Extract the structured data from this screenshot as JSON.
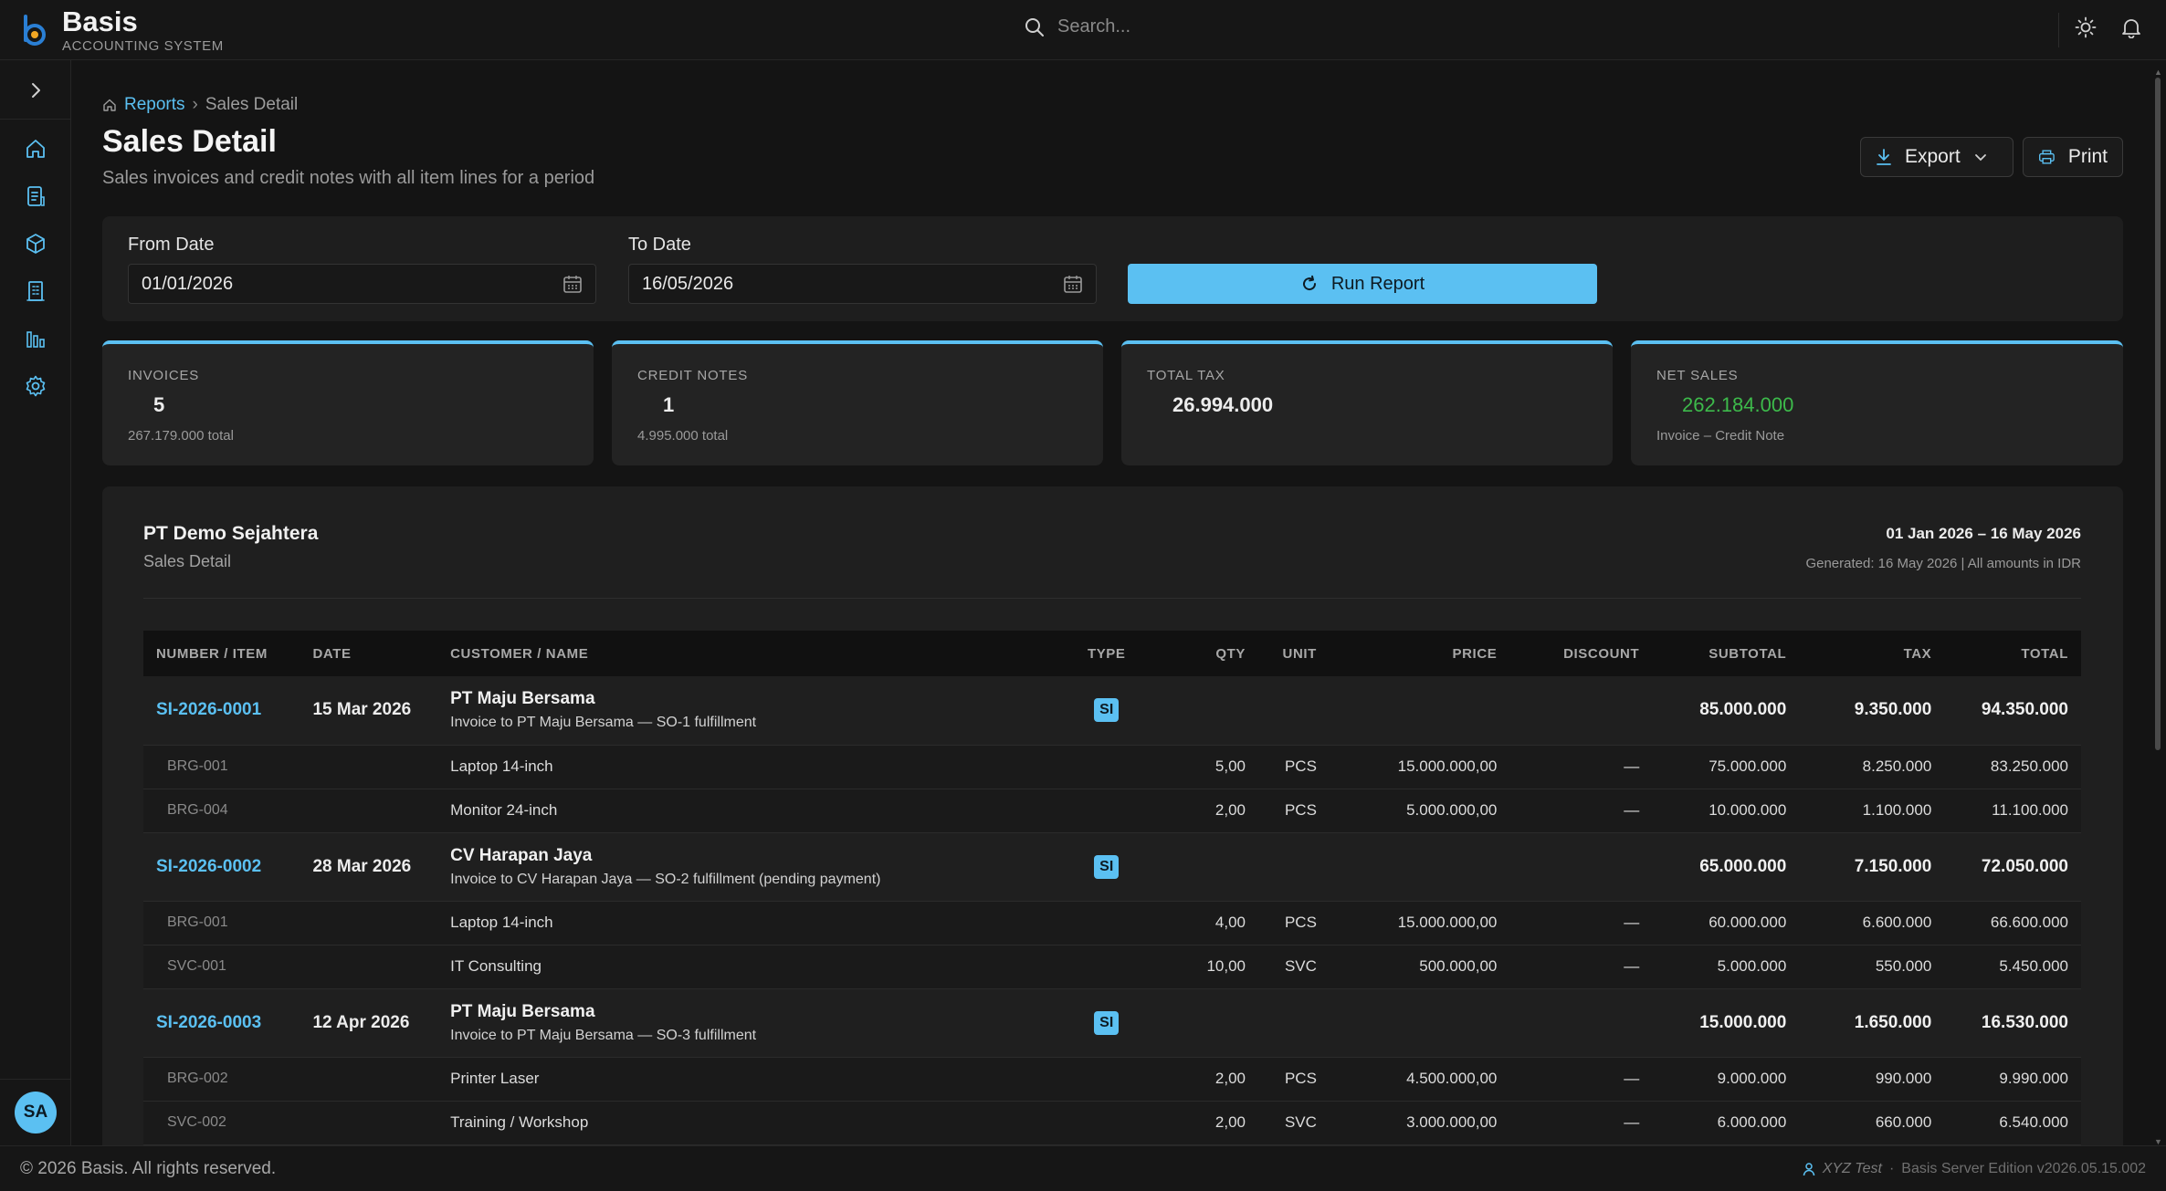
{
  "app": {
    "name": "Basis",
    "subtitle": "ACCOUNTING SYSTEM"
  },
  "search": {
    "placeholder": "Search..."
  },
  "user": {
    "initials": "SA"
  },
  "breadcrumb": {
    "parent": "Reports",
    "separator": "›",
    "current": "Sales Detail"
  },
  "page": {
    "title": "Sales Detail",
    "subtitle": "Sales invoices and credit notes with all item lines for a period"
  },
  "actions": {
    "export_label": "Export",
    "print_label": "Print"
  },
  "filters": {
    "from_label": "From Date",
    "from_value": "01/01/2026",
    "to_label": "To Date",
    "to_value": "16/05/2026",
    "run_label": "Run Report"
  },
  "stats": [
    {
      "label": "INVOICES",
      "value": "5",
      "sub": "267.179.000 total"
    },
    {
      "label": "CREDIT NOTES",
      "value": "1",
      "sub": "4.995.000 total"
    },
    {
      "label": "TOTAL TAX",
      "value": "26.994.000",
      "sub": ""
    },
    {
      "label": "NET SALES",
      "value": "262.184.000",
      "sub": "Invoice – Credit Note"
    }
  ],
  "report": {
    "company": "PT Demo Sejahtera",
    "name": "Sales Detail",
    "period": "01 Jan 2026 – 16 May 2026",
    "generated": "Generated: 16 May 2026 | All amounts in IDR"
  },
  "table": {
    "headers": [
      "NUMBER / ITEM",
      "DATE",
      "CUSTOMER / NAME",
      "TYPE",
      "QTY",
      "UNIT",
      "PRICE",
      "DISCOUNT",
      "SUBTOTAL",
      "TAX",
      "TOTAL"
    ],
    "invoices": [
      {
        "number": "SI-2026-0001",
        "date": "15 Mar 2026",
        "customer": "PT Maju Bersama",
        "desc": "Invoice to PT Maju Bersama — SO-1 fulfillment",
        "type": "SI",
        "subtotal": "85.000.000",
        "tax": "9.350.000",
        "total": "94.350.000",
        "lines": [
          {
            "code": "BRG-001",
            "name": "Laptop 14-inch",
            "qty": "5,00",
            "unit": "PCS",
            "price": "15.000.000,00",
            "discount": "—",
            "subtotal": "75.000.000",
            "tax": "8.250.000",
            "total": "83.250.000"
          },
          {
            "code": "BRG-004",
            "name": "Monitor 24-inch",
            "qty": "2,00",
            "unit": "PCS",
            "price": "5.000.000,00",
            "discount": "—",
            "subtotal": "10.000.000",
            "tax": "1.100.000",
            "total": "11.100.000"
          }
        ]
      },
      {
        "number": "SI-2026-0002",
        "date": "28 Mar 2026",
        "customer": "CV Harapan Jaya",
        "desc": "Invoice to CV Harapan Jaya — SO-2 fulfillment (pending payment)",
        "type": "SI",
        "subtotal": "65.000.000",
        "tax": "7.150.000",
        "total": "72.050.000",
        "lines": [
          {
            "code": "BRG-001",
            "name": "Laptop 14-inch",
            "qty": "4,00",
            "unit": "PCS",
            "price": "15.000.000,00",
            "discount": "—",
            "subtotal": "60.000.000",
            "tax": "6.600.000",
            "total": "66.600.000"
          },
          {
            "code": "SVC-001",
            "name": "IT Consulting",
            "qty": "10,00",
            "unit": "SVC",
            "price": "500.000,00",
            "discount": "—",
            "subtotal": "5.000.000",
            "tax": "550.000",
            "total": "5.450.000"
          }
        ]
      },
      {
        "number": "SI-2026-0003",
        "date": "12 Apr 2026",
        "customer": "PT Maju Bersama",
        "desc": "Invoice to PT Maju Bersama — SO-3 fulfillment",
        "type": "SI",
        "subtotal": "15.000.000",
        "tax": "1.650.000",
        "total": "16.530.000",
        "lines": [
          {
            "code": "BRG-002",
            "name": "Printer Laser",
            "qty": "2,00",
            "unit": "PCS",
            "price": "4.500.000,00",
            "discount": "—",
            "subtotal": "9.000.000",
            "tax": "990.000",
            "total": "9.990.000"
          },
          {
            "code": "SVC-002",
            "name": "Training / Workshop",
            "qty": "2,00",
            "unit": "SVC",
            "price": "3.000.000,00",
            "discount": "—",
            "subtotal": "6.000.000",
            "tax": "660.000",
            "total": "6.540.000"
          }
        ]
      }
    ]
  },
  "footer": {
    "copyright": "© 2026 Basis. All rights reserved.",
    "user": "XYZ Test",
    "edition": "Basis Server Edition v2026.05.15.002"
  },
  "colors": {
    "accent": "#5bc0f2",
    "positive": "#3dba4b",
    "background": "#141414",
    "card": "#1f1f1f"
  }
}
